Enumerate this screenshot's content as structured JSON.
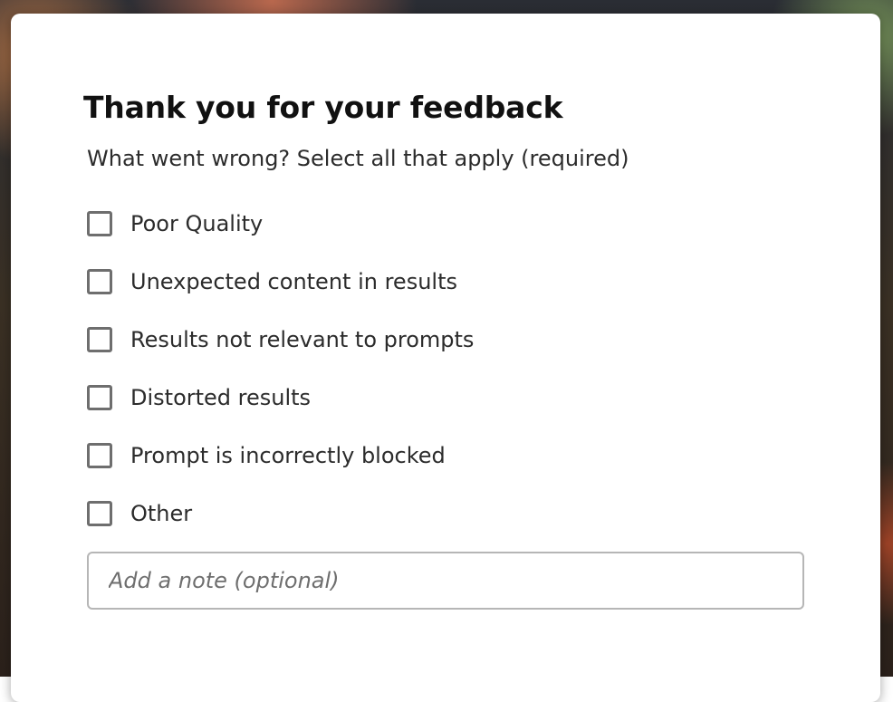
{
  "dialog": {
    "title": "Thank you for your feedback",
    "subtitle": "What went wrong? Select all that apply (required)",
    "options": [
      {
        "label": "Poor Quality",
        "checked": false
      },
      {
        "label": "Unexpected content in results",
        "checked": false
      },
      {
        "label": "Results not relevant to prompts",
        "checked": false
      },
      {
        "label": "Distorted results",
        "checked": false
      },
      {
        "label": "Prompt is incorrectly blocked",
        "checked": false
      },
      {
        "label": "Other",
        "checked": false
      }
    ],
    "note": {
      "value": "",
      "placeholder": "Add a note (optional)"
    }
  },
  "colors": {
    "dialog_background": "#ffffff",
    "text": "#2c2c2c",
    "checkbox_border": "#6e6e6e",
    "input_border": "#b6b6b6"
  }
}
